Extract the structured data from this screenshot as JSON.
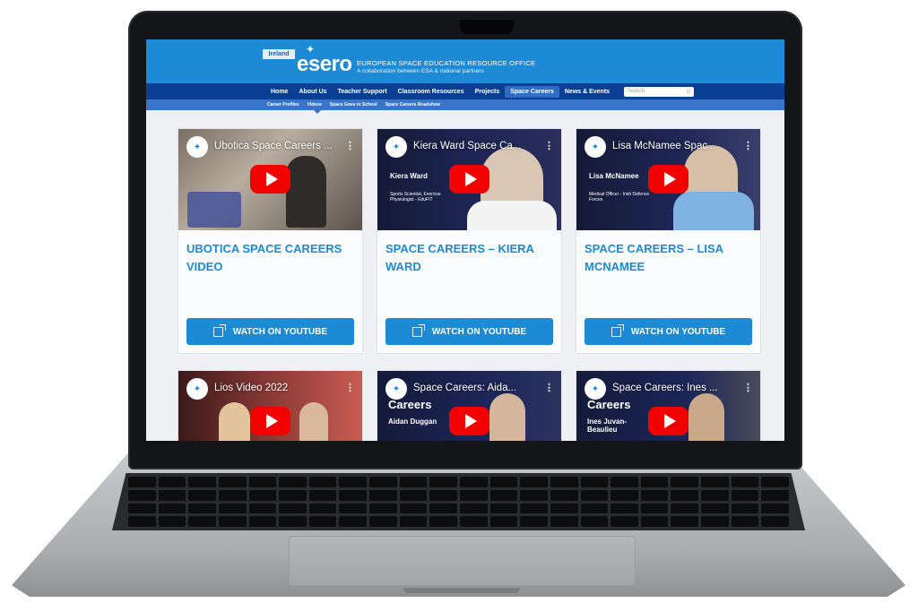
{
  "header": {
    "country_tag": "Ireland",
    "logo_text": "esero",
    "org_title": "EUROPEAN SPACE EDUCATION RESOURCE OFFICE",
    "org_subtitle": "A collaboration between ESA & national partners"
  },
  "nav": {
    "items": [
      {
        "label": "Home"
      },
      {
        "label": "About Us"
      },
      {
        "label": "Teacher Support"
      },
      {
        "label": "Classroom Resources"
      },
      {
        "label": "Projects"
      },
      {
        "label": "Space Careers",
        "active": true
      },
      {
        "label": "News & Events"
      }
    ],
    "search_placeholder": "Search"
  },
  "subnav": {
    "items": [
      {
        "label": "Career Profiles"
      },
      {
        "label": "Videos"
      },
      {
        "label": "Space Goes to School"
      },
      {
        "label": "Space Careers Roadshow"
      }
    ]
  },
  "cards": [
    {
      "video_title": "Ubotica Space Careers ...",
      "title": "UBOTICA SPACE CAREERS VIDEO",
      "button": "WATCH ON YOUTUBE"
    },
    {
      "video_title": "Kiera Ward Space Ca...",
      "title": "SPACE CAREERS – KIERA WARD",
      "button": "WATCH ON YOUTUBE",
      "overlay_name": "Kiera Ward",
      "overlay_role": "Sports Scientist, Exercise Physiologist - EduFIT"
    },
    {
      "video_title": "Lisa McNamee Spac...",
      "title": "SPACE CAREERS – LISA MCNAMEE",
      "button": "WATCH ON YOUTUBE",
      "overlay_name": "Lisa McNamee",
      "overlay_role": "Medical Officer - Irish Defence Forces"
    },
    {
      "video_title": "Lios Video 2022"
    },
    {
      "video_title": "Space Careers: Aida...",
      "overlay_heading": "Careers",
      "overlay_name": "Aidan Duggan"
    },
    {
      "video_title": "Space Careers: Ines ...",
      "overlay_heading": "Careers",
      "overlay_name": "Ines Juvan-Beaulieu"
    }
  ],
  "colors": {
    "brand_blue": "#1d8ad6",
    "nav_dark": "#0a3f94",
    "youtube_red": "#f20000"
  }
}
